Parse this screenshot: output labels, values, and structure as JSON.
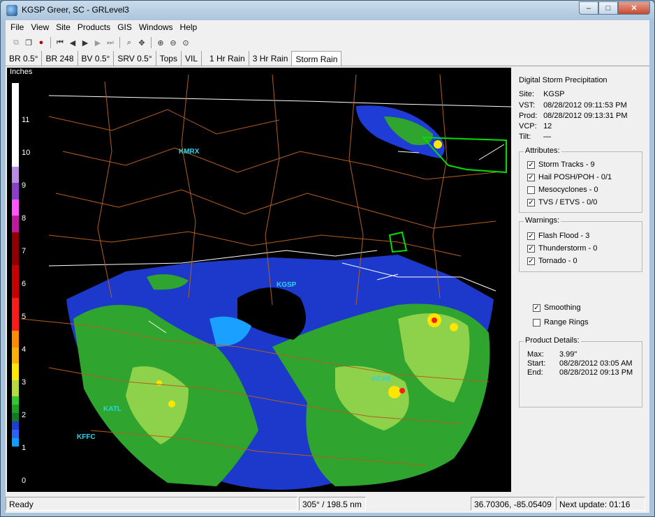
{
  "window": {
    "title": "KGSP Greer, SC - GRLevel3"
  },
  "titlebar_buttons": {
    "minimize": "–",
    "maximize": "□",
    "close": "✕"
  },
  "menu": [
    "File",
    "View",
    "Site",
    "Products",
    "GIS",
    "Windows",
    "Help"
  ],
  "toolbar_icons": [
    "copy-icon",
    "copy-all-icon",
    "record-icon",
    "first-frame-icon",
    "prev-frame-icon",
    "play-icon",
    "next-frame-icon",
    "last-frame-icon",
    "zoom-icon",
    "pan-icon",
    "zoom-in-icon",
    "zoom-out-icon",
    "zoom-reset-icon"
  ],
  "tabs": [
    "BR 0.5°",
    "BR 248",
    "BV 0.5°",
    "SRV 0.5°",
    "Tops",
    "VIL",
    "1 Hr Rain",
    "3 Hr Rain",
    "Storm Rain"
  ],
  "active_tab": "Storm Rain",
  "legend": {
    "unit": "Inches",
    "labels": [
      "11",
      "10",
      "9",
      "8",
      "7",
      "6",
      "5",
      "4",
      "3",
      "2",
      "1",
      "0"
    ]
  },
  "map_labels": {
    "kmrx": "KMRX",
    "kgsp": "KGSP",
    "kcae": "KCAE",
    "katl": "KATL",
    "kffc": "KFFC"
  },
  "panel": {
    "title": "Digital Storm Precipitation",
    "site_label": "Site:",
    "site": "KGSP",
    "vst_label": "VST:",
    "vst": "08/28/2012  09:11:53 PM",
    "prod_label": "Prod:",
    "prod": "08/28/2012  09:13:31 PM",
    "vcp_label": "VCP:",
    "vcp": "12",
    "tilt_label": "Tilt:",
    "tilt": "—"
  },
  "attributes": {
    "title": "Attributes:",
    "items": [
      {
        "label": "Storm Tracks - 9",
        "checked": "✓"
      },
      {
        "label": "Hail POSH/POH - 0/1",
        "checked": "✓"
      },
      {
        "label": "Mesocyclones - 0",
        "checked": ""
      },
      {
        "label": "TVS / ETVS - 0/0",
        "checked": "✓"
      }
    ]
  },
  "warnings": {
    "title": "Warnings:",
    "items": [
      {
        "label": "Flash Flood - 3",
        "checked": "✓"
      },
      {
        "label": "Thunderstorm - 0",
        "checked": "✓"
      },
      {
        "label": "Tornado - 0",
        "checked": "✓"
      }
    ]
  },
  "options": {
    "smoothing": {
      "label": "Smoothing",
      "checked": "✓"
    },
    "range_rings": {
      "label": "Range Rings",
      "checked": ""
    }
  },
  "product_details": {
    "title": "Product Details:",
    "max_label": "Max:",
    "max": "3.99\"",
    "start_label": "Start:",
    "start": "08/28/2012  03:05 AM",
    "end_label": "End:",
    "end": "08/28/2012  09:13 PM"
  },
  "status": {
    "ready": "Ready",
    "azimuth_range": "305° / 198.5 nm",
    "coords": "36.70306, -85.05409",
    "next_update": "Next update: 01:16"
  },
  "legend_colors": [
    "#ffffff",
    "#b98de0",
    "#8b3fc8",
    "#ff55ff",
    "#c0189e",
    "#8e0000",
    "#c80000",
    "#ff1a1a",
    "#ff8c00",
    "#ffe600",
    "#32c832",
    "#1ea01e",
    "#1f3cd7",
    "#0aa0ff"
  ]
}
